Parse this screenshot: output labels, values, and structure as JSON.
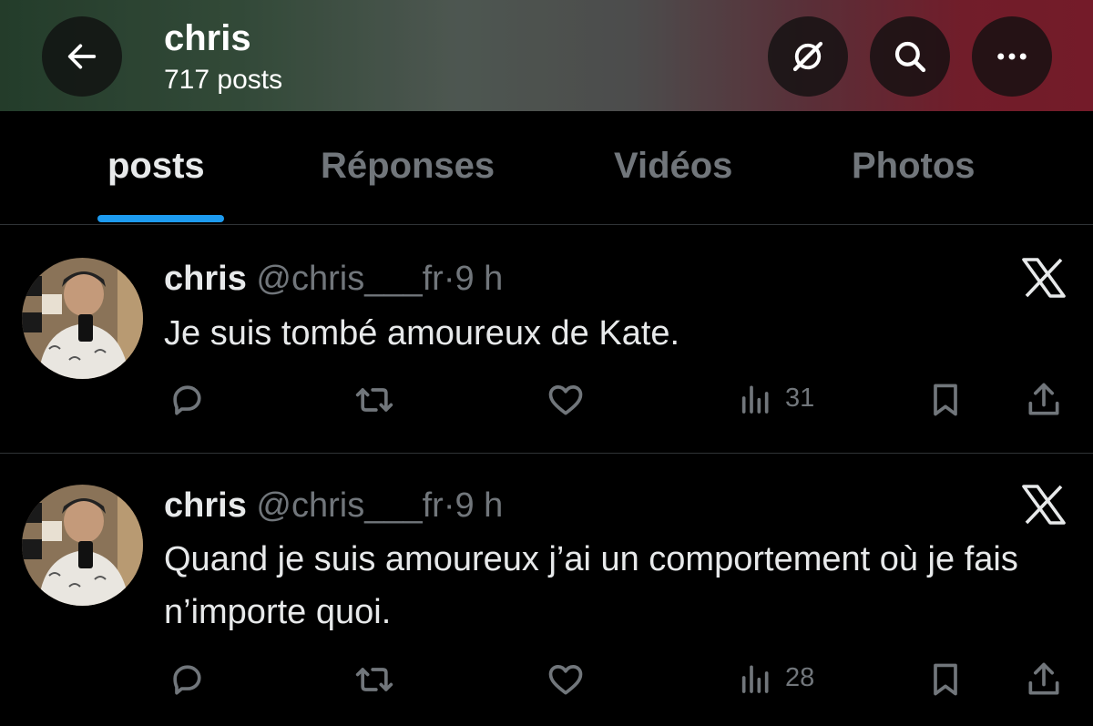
{
  "header": {
    "name": "chris",
    "post_count": "717 posts",
    "icons": [
      "back-arrow-icon",
      "grok-icon",
      "search-icon",
      "more-icon"
    ]
  },
  "tabs": [
    {
      "label": "posts",
      "active": true
    },
    {
      "label": "Réponses",
      "active": false
    },
    {
      "label": "Vidéos",
      "active": false
    },
    {
      "label": "Photos",
      "active": false
    }
  ],
  "posts": [
    {
      "author": "chris",
      "handle": "@chris___fr",
      "separator": "·",
      "time": "9 h",
      "text": "Je suis tombé amoureux de Kate.",
      "views": "31"
    },
    {
      "author": "chris",
      "handle": "@chris___fr",
      "separator": "·",
      "time": "9 h",
      "text": "Quand je suis amoureux j’ai un comportement où je fais n’importe quoi.",
      "views": "28"
    }
  ],
  "colors": {
    "accent": "#1d9bf0",
    "muted": "#71767b",
    "background": "#000000"
  }
}
